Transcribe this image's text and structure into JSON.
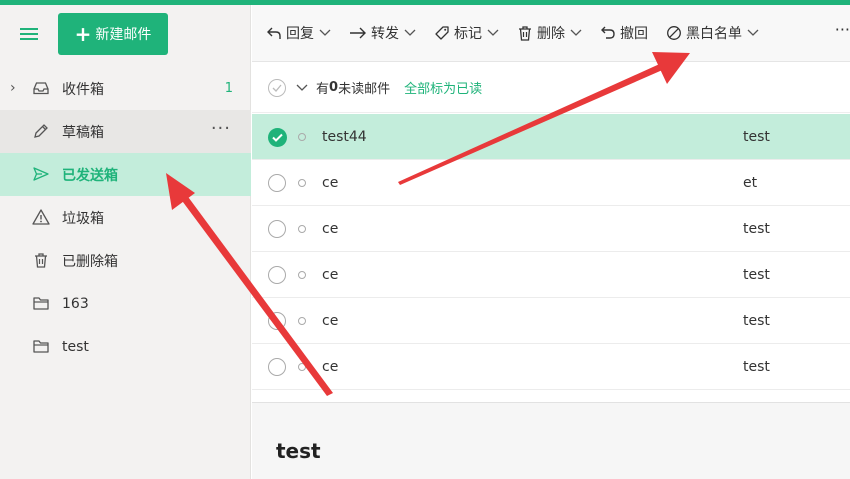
{
  "sidebar": {
    "compose_label": "新建邮件",
    "folders": [
      {
        "label": "收件箱",
        "icon": "inbox-icon",
        "count": "1",
        "expand": "›"
      },
      {
        "label": "草稿箱",
        "icon": "pencil-icon",
        "more": "···"
      },
      {
        "label": "已发送箱",
        "icon": "send-icon"
      },
      {
        "label": "垃圾箱",
        "icon": "warning-icon"
      },
      {
        "label": "已删除箱",
        "icon": "trash-icon"
      },
      {
        "label": "163",
        "icon": "folder-icon"
      },
      {
        "label": "test",
        "icon": "folder-icon"
      }
    ]
  },
  "toolbar": {
    "reply": "回复",
    "forward": "转发",
    "tag": "标记",
    "delete": "删除",
    "recall": "撤回",
    "blacklist": "黑白名单",
    "more": "···"
  },
  "list_header": {
    "prefix": "有",
    "unread_count": "0",
    "suffix": "未读邮件",
    "mark_all": "全部标为已读"
  },
  "rows": [
    {
      "sender": "test44",
      "subject": "test",
      "selected": true
    },
    {
      "sender": "ce",
      "subject": "et"
    },
    {
      "sender": "ce",
      "subject": "test"
    },
    {
      "sender": "ce",
      "subject": "test"
    },
    {
      "sender": "ce",
      "subject": "test"
    },
    {
      "sender": "ce",
      "subject": "test"
    }
  ],
  "preview": {
    "title": "test"
  },
  "colors": {
    "accent": "#1fb37a",
    "selected_bg": "#c3eddb",
    "arrow": "#e8393a"
  }
}
